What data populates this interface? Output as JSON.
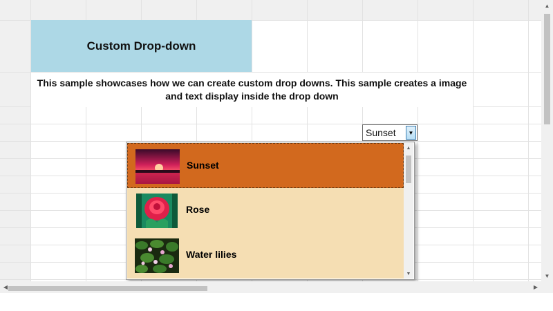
{
  "sheet": {
    "title": "Custom Drop-down",
    "description": "This sample showcases how we can create custom drop downs. This sample creates a image and text display inside the drop down"
  },
  "combo": {
    "value": "Sunset"
  },
  "dropdown": {
    "items": [
      {
        "label": "Sunset",
        "image": "sunset-photo",
        "selected": true
      },
      {
        "label": "Rose",
        "image": "rose-photo",
        "selected": false
      },
      {
        "label": "Water lilies",
        "image": "water-lilies-photo",
        "selected": false
      }
    ]
  },
  "colors": {
    "title_bg": "#add8e6",
    "dropdown_bg": "#f5deb3",
    "selected_bg": "#d2691e"
  }
}
